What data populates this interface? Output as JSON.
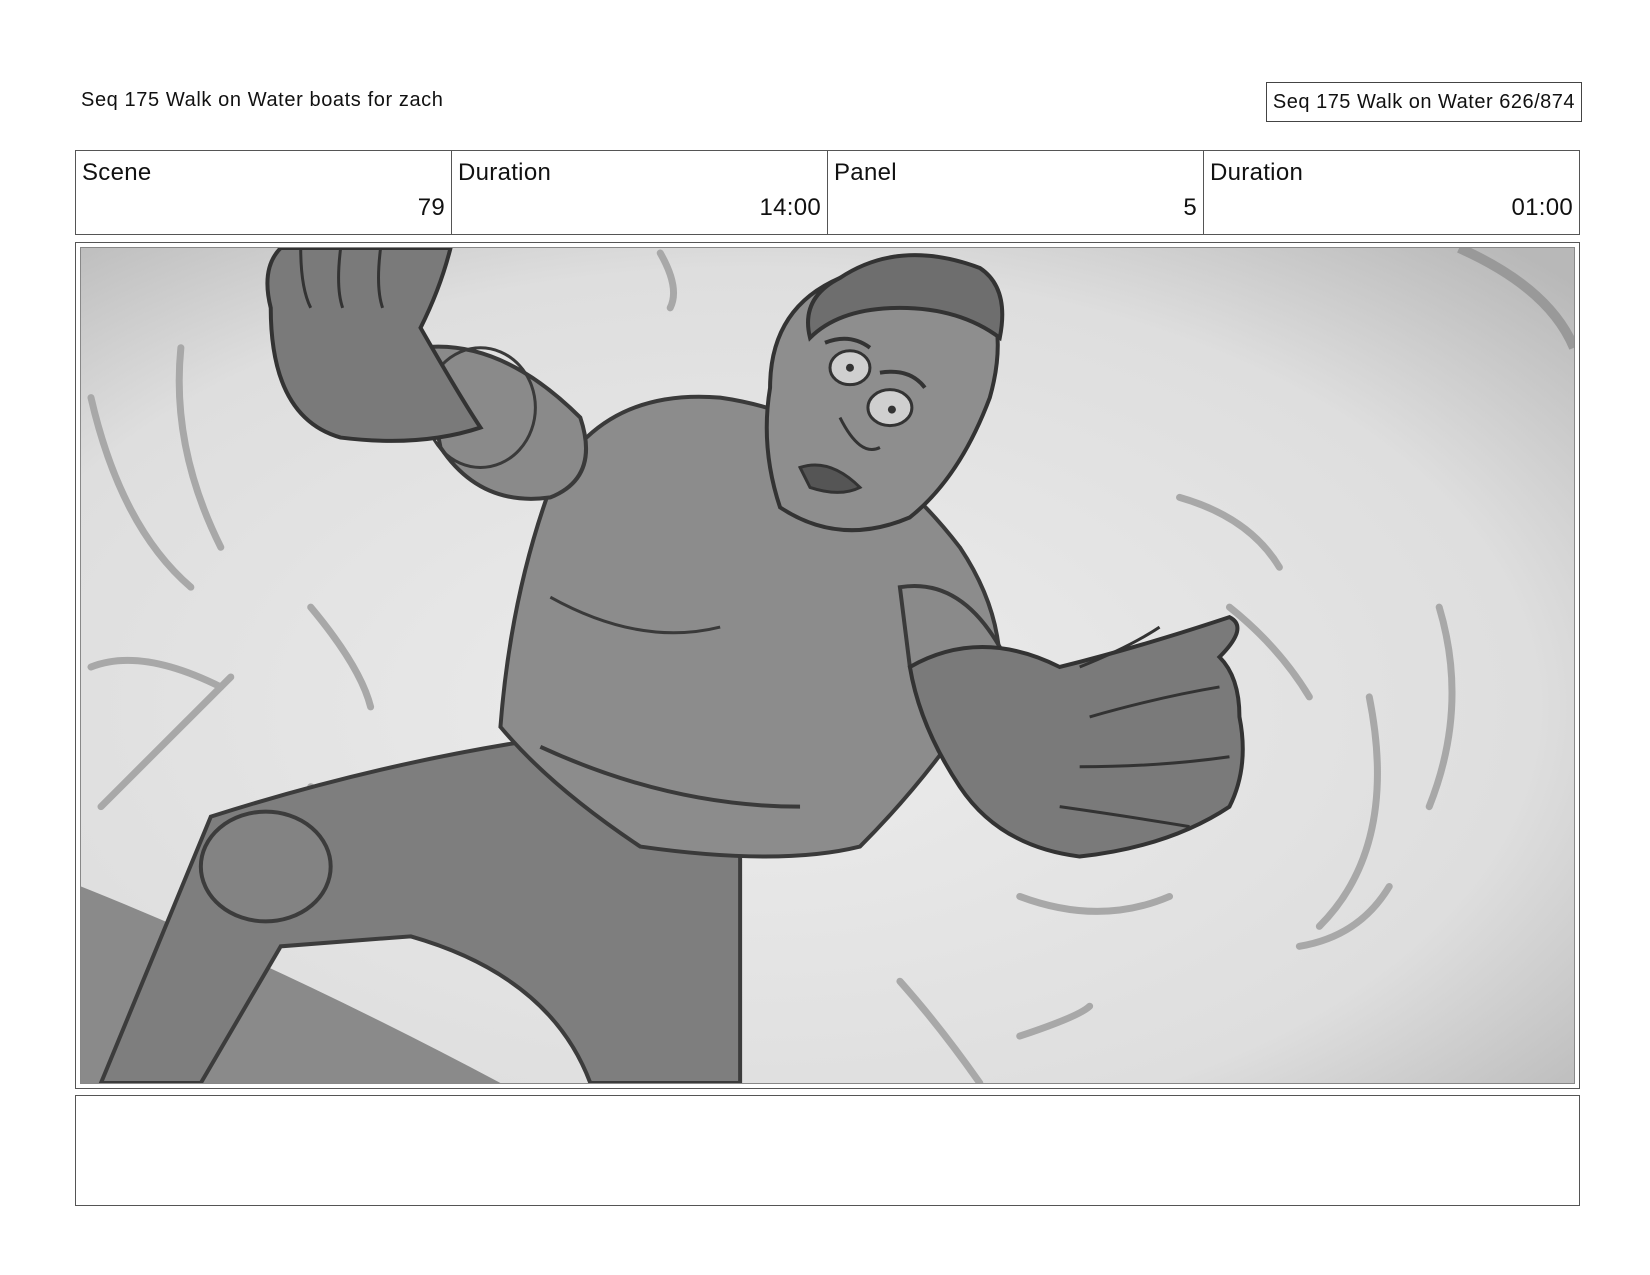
{
  "header": {
    "title": "Seq 175 Walk on Water  boats for zach",
    "page_label": "Seq 175 Walk on Water 626/874"
  },
  "info": {
    "scene_label": "Scene",
    "scene_value": "79",
    "scene_duration_label": "Duration",
    "scene_duration_value": "14:00",
    "panel_label": "Panel",
    "panel_value": "5",
    "panel_duration_label": "Duration",
    "panel_duration_value": "01:00"
  },
  "notes": {
    "text": ""
  }
}
